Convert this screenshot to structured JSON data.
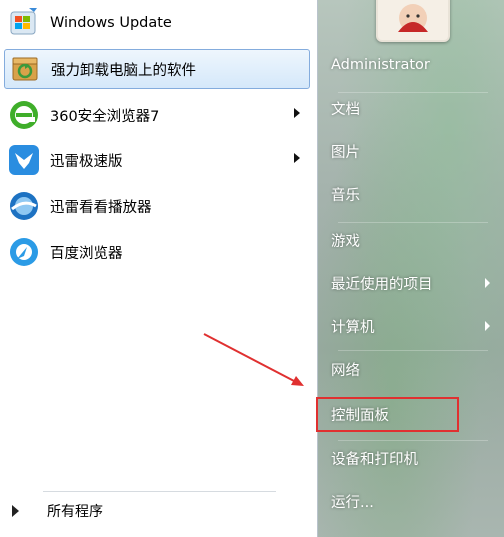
{
  "left_panel": {
    "programs": [
      {
        "label": "Windows Update",
        "icon": "windows-update-icon",
        "selected": false,
        "has_submenu": false
      },
      {
        "label": "强力卸载电脑上的软件",
        "icon": "uninstaller-icon",
        "selected": true,
        "has_submenu": false
      },
      {
        "label": "360安全浏览器7",
        "icon": "360-browser-icon",
        "selected": false,
        "has_submenu": true
      },
      {
        "label": "迅雷极速版",
        "icon": "thunder-icon",
        "selected": false,
        "has_submenu": true
      },
      {
        "label": "迅雷看看播放器",
        "icon": "xunlei-player-icon",
        "selected": false,
        "has_submenu": false
      },
      {
        "label": "百度浏览器",
        "icon": "baidu-browser-icon",
        "selected": false,
        "has_submenu": false
      }
    ],
    "all_programs_label": "所有程序"
  },
  "right_panel": {
    "items": [
      {
        "label": "Administrator",
        "has_submenu": false
      },
      {
        "label": "文档",
        "has_submenu": false
      },
      {
        "label": "图片",
        "has_submenu": false
      },
      {
        "label": "音乐",
        "has_submenu": false
      },
      {
        "label": "游戏",
        "has_submenu": false
      },
      {
        "label": "最近使用的项目",
        "has_submenu": true
      },
      {
        "label": "计算机",
        "has_submenu": true
      },
      {
        "label": "网络",
        "has_submenu": false
      },
      {
        "label": "控制面板",
        "has_submenu": false,
        "highlighted": true
      },
      {
        "label": "设备和打印机",
        "has_submenu": false
      },
      {
        "label": "运行...",
        "has_submenu": false
      }
    ]
  },
  "annotation": {
    "arrow_color": "#e03030",
    "box_color": "#e03030"
  },
  "colors": {
    "selected_bg": "#d5e8fa",
    "selected_border": "#84acdd"
  }
}
